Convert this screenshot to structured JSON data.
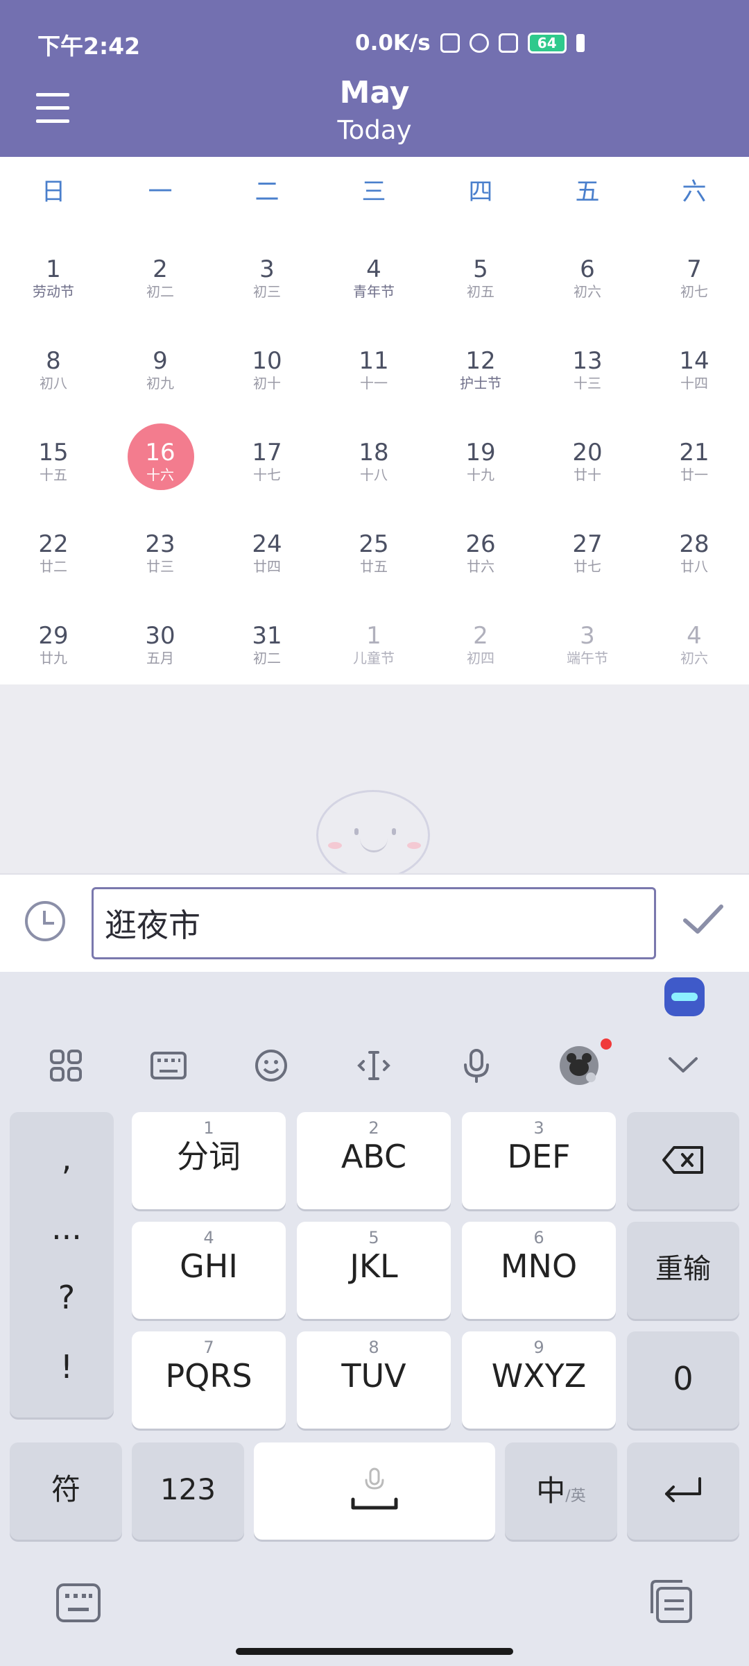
{
  "status_bar": {
    "time": "下午2:42",
    "speed": "0.0K/s",
    "battery": "64"
  },
  "header": {
    "month": "May",
    "subtitle": "Today"
  },
  "calendar": {
    "weekdays": [
      "日",
      "一",
      "二",
      "三",
      "四",
      "五",
      "六"
    ],
    "weeks": [
      [
        {
          "d": "1",
          "l": "劳动节",
          "f": true
        },
        {
          "d": "2",
          "l": "初二"
        },
        {
          "d": "3",
          "l": "初三"
        },
        {
          "d": "4",
          "l": "青年节",
          "f": true
        },
        {
          "d": "5",
          "l": "初五"
        },
        {
          "d": "6",
          "l": "初六"
        },
        {
          "d": "7",
          "l": "初七"
        }
      ],
      [
        {
          "d": "8",
          "l": "初八"
        },
        {
          "d": "9",
          "l": "初九"
        },
        {
          "d": "10",
          "l": "初十"
        },
        {
          "d": "11",
          "l": "十一"
        },
        {
          "d": "12",
          "l": "护士节",
          "f": true
        },
        {
          "d": "13",
          "l": "十三"
        },
        {
          "d": "14",
          "l": "十四"
        }
      ],
      [
        {
          "d": "15",
          "l": "十五"
        },
        {
          "d": "16",
          "l": "十六",
          "today": true
        },
        {
          "d": "17",
          "l": "十七"
        },
        {
          "d": "18",
          "l": "十八"
        },
        {
          "d": "19",
          "l": "十九"
        },
        {
          "d": "20",
          "l": "廿十"
        },
        {
          "d": "21",
          "l": "廿一"
        }
      ],
      [
        {
          "d": "22",
          "l": "廿二"
        },
        {
          "d": "23",
          "l": "廿三"
        },
        {
          "d": "24",
          "l": "廿四"
        },
        {
          "d": "25",
          "l": "廿五"
        },
        {
          "d": "26",
          "l": "廿六"
        },
        {
          "d": "27",
          "l": "廿七"
        },
        {
          "d": "28",
          "l": "廿八"
        }
      ],
      [
        {
          "d": "29",
          "l": "廿九"
        },
        {
          "d": "30",
          "l": "五月"
        },
        {
          "d": "31",
          "l": "初二"
        },
        {
          "d": "1",
          "l": "儿童节",
          "o": true
        },
        {
          "d": "2",
          "l": "初四",
          "o": true
        },
        {
          "d": "3",
          "l": "端午节",
          "o": true
        },
        {
          "d": "4",
          "l": "初六",
          "o": true
        }
      ]
    ]
  },
  "note_input": {
    "value": "逛夜市"
  },
  "keyboard": {
    "punct": [
      ",",
      "...",
      "?",
      "!"
    ],
    "keys": [
      {
        "num": "1",
        "label": "分词"
      },
      {
        "num": "2",
        "label": "ABC"
      },
      {
        "num": "3",
        "label": "DEF"
      },
      {
        "num": "4",
        "label": "GHI"
      },
      {
        "num": "5",
        "label": "JKL"
      },
      {
        "num": "6",
        "label": "MNO"
      },
      {
        "num": "7",
        "label": "PQRS"
      },
      {
        "num": "8",
        "label": "TUV"
      },
      {
        "num": "9",
        "label": "WXYZ"
      }
    ],
    "reenter": "重输",
    "zero": "0",
    "symbols": "符",
    "numeric": "123",
    "lang_main": "中",
    "lang_alt": "/英"
  }
}
